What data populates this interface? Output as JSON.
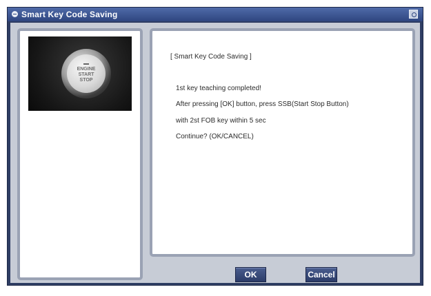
{
  "window": {
    "title": "Smart Key Code Saving",
    "title_icon": "app-icon",
    "close_icon": "minimize-icon"
  },
  "photo": {
    "button_text": [
      "ENGINE",
      "START",
      "STOP"
    ]
  },
  "message": {
    "heading": "[ Smart Key Code Saving ]",
    "line1": "1st key teaching completed!",
    "line2": "After pressing [OK] button, press SSB(Start Stop Button)",
    "line3": "with 2st FOB key within 5 sec",
    "line4": "Continue? (OK/CANCEL)"
  },
  "buttons": {
    "ok": "OK",
    "cancel": "Cancel"
  },
  "colors": {
    "titlebar": "#2f4680",
    "button": "#2c3c68",
    "client": "#c7ccd6"
  }
}
